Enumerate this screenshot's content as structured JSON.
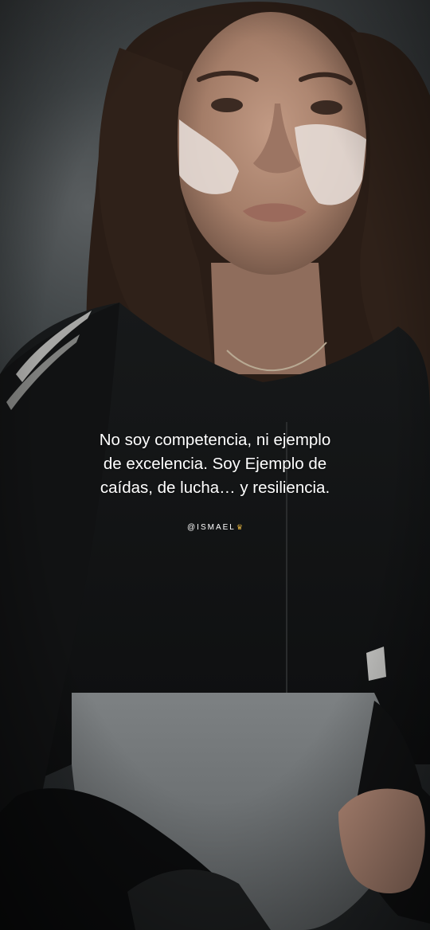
{
  "caption": {
    "lines": [
      "No soy competencia, ni ejemplo",
      "de excelencia. Soy Ejemplo de",
      "caídas, de lucha… y resiliencia."
    ]
  },
  "watermark": {
    "handle": "@ISMAEL",
    "crown_icon": "crown-icon"
  },
  "colors": {
    "jacket": "#141516",
    "pants": "#8e9294",
    "skin": "#b08872",
    "hair": "#2a1d16",
    "wall": "#3f4446"
  }
}
